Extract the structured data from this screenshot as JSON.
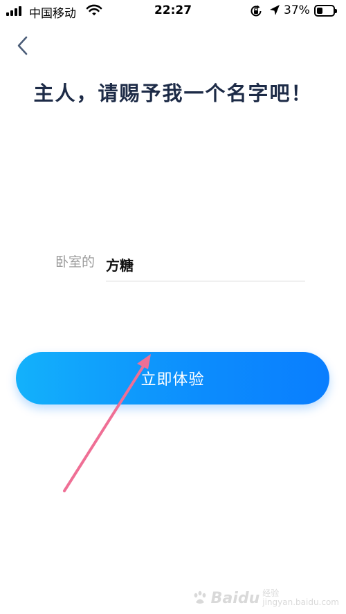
{
  "status_bar": {
    "carrier": "中国移动",
    "time": "22:27",
    "battery_percent_text": "37%",
    "battery_level": 0.37,
    "icons": [
      "signal-icon",
      "wifi-icon",
      "rotation-lock-icon",
      "location-arrow-icon",
      "battery-icon"
    ]
  },
  "nav": {
    "back_icon": "chevron-left-icon"
  },
  "title": "主人，请赐予我一个名字吧！",
  "name_field": {
    "prefix": "卧室的",
    "value": "方糖"
  },
  "primary_button": {
    "label": "立即体验"
  },
  "colors": {
    "title": "#1d2b47",
    "button_start": "#13b1fb",
    "button_end": "#0a7efe",
    "arrow": "#ef6f95"
  },
  "watermark": {
    "brand": "Baidu",
    "sub_line_1": "经验",
    "sub_line_2": "jingyan.baidu.com"
  }
}
